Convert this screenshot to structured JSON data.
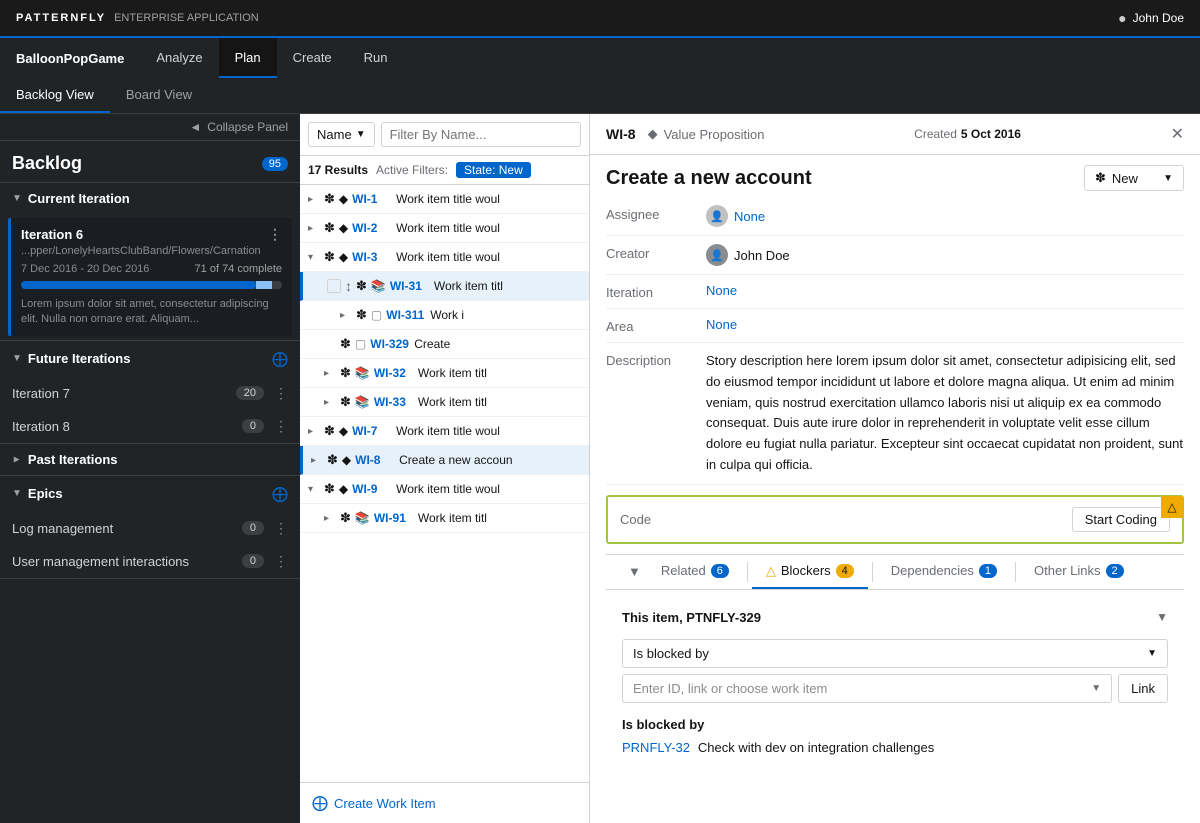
{
  "topNav": {
    "brand": "PATTERNFLY",
    "appType": "ENTERPRISE APPLICATION",
    "user": "John Doe"
  },
  "appNav": {
    "appName": "BalloonPopGame",
    "items": [
      {
        "label": "Analyze",
        "active": false
      },
      {
        "label": "Plan",
        "active": true
      },
      {
        "label": "Create",
        "active": false
      },
      {
        "label": "Run",
        "active": false
      }
    ]
  },
  "secondNav": {
    "items": [
      {
        "label": "Backlog View",
        "active": true
      },
      {
        "label": "Board View",
        "active": false
      }
    ]
  },
  "sidebar": {
    "collapse_label": "Collapse Panel",
    "backlog_title": "Backlog",
    "backlog_count": "95",
    "sections": {
      "currentIteration": {
        "title": "Current Iteration",
        "iteration": {
          "name": "Iteration 6",
          "path": "...pper/LonelyHeartsClubBand/Flowers/Carnation",
          "dates": "7 Dec 2016 - 20 Dec 2016",
          "complete": "71 of 74 complete",
          "progress_pct": 96,
          "description": "Lorem ipsum dolor sit amet, consectetur adipiscing elit. Nulla non ornare erat. Aliquam..."
        }
      },
      "futureIterations": {
        "title": "Future Iterations",
        "items": [
          {
            "name": "Iteration 7",
            "count": "20"
          },
          {
            "name": "Iteration 8",
            "count": "0"
          }
        ]
      },
      "pastIterations": {
        "title": "Past Iterations"
      },
      "epics": {
        "title": "Epics",
        "items": [
          {
            "name": "Log management",
            "count": "0"
          },
          {
            "name": "User management interactions",
            "count": "0"
          }
        ]
      }
    }
  },
  "workList": {
    "filter_placeholder": "Filter By Name...",
    "name_label": "Name",
    "results_count": "17 Results",
    "active_filters_label": "Active Filters:",
    "filter_state": "State: New",
    "items": [
      {
        "id": "WI-1",
        "title": "Work item title woul",
        "type": "star",
        "subtype": "diamond",
        "expanded": false,
        "indented": 0
      },
      {
        "id": "WI-2",
        "title": "Work item title woul",
        "type": "star",
        "subtype": "diamond",
        "expanded": false,
        "indented": 0
      },
      {
        "id": "WI-3",
        "title": "Work item title woul",
        "type": "star",
        "subtype": "diamond",
        "expanded": true,
        "indented": 0
      },
      {
        "id": "WI-31",
        "title": "Work item titl",
        "type": "star",
        "subtype": "book",
        "expanded": false,
        "indented": 1,
        "dragging": true
      },
      {
        "id": "WI-311",
        "title": "Work i",
        "type": "star",
        "subtype": "book-alt",
        "expanded": false,
        "indented": 2
      },
      {
        "id": "WI-329",
        "title": "Create",
        "type": "star",
        "subtype": "book-alt",
        "expanded": false,
        "indented": 2
      },
      {
        "id": "WI-32",
        "title": "Work item titl",
        "type": "star",
        "subtype": "book",
        "expanded": false,
        "indented": 1
      },
      {
        "id": "WI-33",
        "title": "Work item titl",
        "type": "star",
        "subtype": "book",
        "expanded": false,
        "indented": 1
      },
      {
        "id": "WI-7",
        "title": "Work item title woul",
        "type": "star",
        "subtype": "diamond",
        "expanded": false,
        "indented": 0
      },
      {
        "id": "WI-8",
        "title": "Create a new accoun",
        "type": "star",
        "subtype": "diamond",
        "expanded": false,
        "indented": 0,
        "selected": true
      },
      {
        "id": "WI-9",
        "title": "Work item title woul",
        "type": "star",
        "subtype": "diamond",
        "expanded": true,
        "indented": 0
      },
      {
        "id": "WI-91",
        "title": "Work item titl",
        "type": "star",
        "subtype": "book",
        "expanded": false,
        "indented": 1
      }
    ],
    "create_label": "Create Work Item"
  },
  "detail": {
    "wi_id": "WI-8",
    "type_icon": "diamond",
    "type_label": "Value Proposition",
    "created_label": "Created",
    "created_date": "5 Oct 2016",
    "title": "Create a new account",
    "status_label": "New",
    "fields": {
      "assignee_label": "Assignee",
      "assignee_value": "None",
      "creator_label": "Creator",
      "creator_value": "John Doe",
      "iteration_label": "Iteration",
      "iteration_value": "None",
      "area_label": "Area",
      "area_value": "None",
      "description_label": "Description",
      "description_text": "Story description here lorem ipsum dolor sit amet, consectetur adipisicing elit, sed do eiusmod tempor incididunt ut labore et dolore magna aliqua. Ut enim ad minim veniam, quis nostrud exercitation ullamco laboris nisi ut aliquip ex ea commodo consequat. Duis aute irure dolor in reprehenderit in voluptate velit esse cillum dolore eu fugiat nulla pariatur. Excepteur sint occaecat cupidatat non proident, sunt in culpa qui officia."
    },
    "code_section": {
      "label": "Code",
      "button_label": "Start Coding"
    },
    "tabs": [
      {
        "label": "Related",
        "count": "6",
        "active": false,
        "type": "normal"
      },
      {
        "label": "Blockers",
        "count": "4",
        "active": true,
        "type": "warning"
      },
      {
        "label": "Dependencies",
        "count": "1",
        "active": false,
        "type": "normal"
      },
      {
        "label": "Other Links",
        "count": "2",
        "active": false,
        "type": "normal"
      }
    ],
    "blockers": {
      "item_title": "This item, PTNFLY-329",
      "blocked_by_label": "Is blocked by",
      "blocked_by_option": "Is blocked by",
      "link_placeholder": "Enter ID, link or choose work item",
      "link_btn": "Link",
      "is_blocked_by": "Is blocked by",
      "blocker_id": "PRNFLY-32",
      "blocker_title": "Check with dev on integration challenges"
    }
  }
}
